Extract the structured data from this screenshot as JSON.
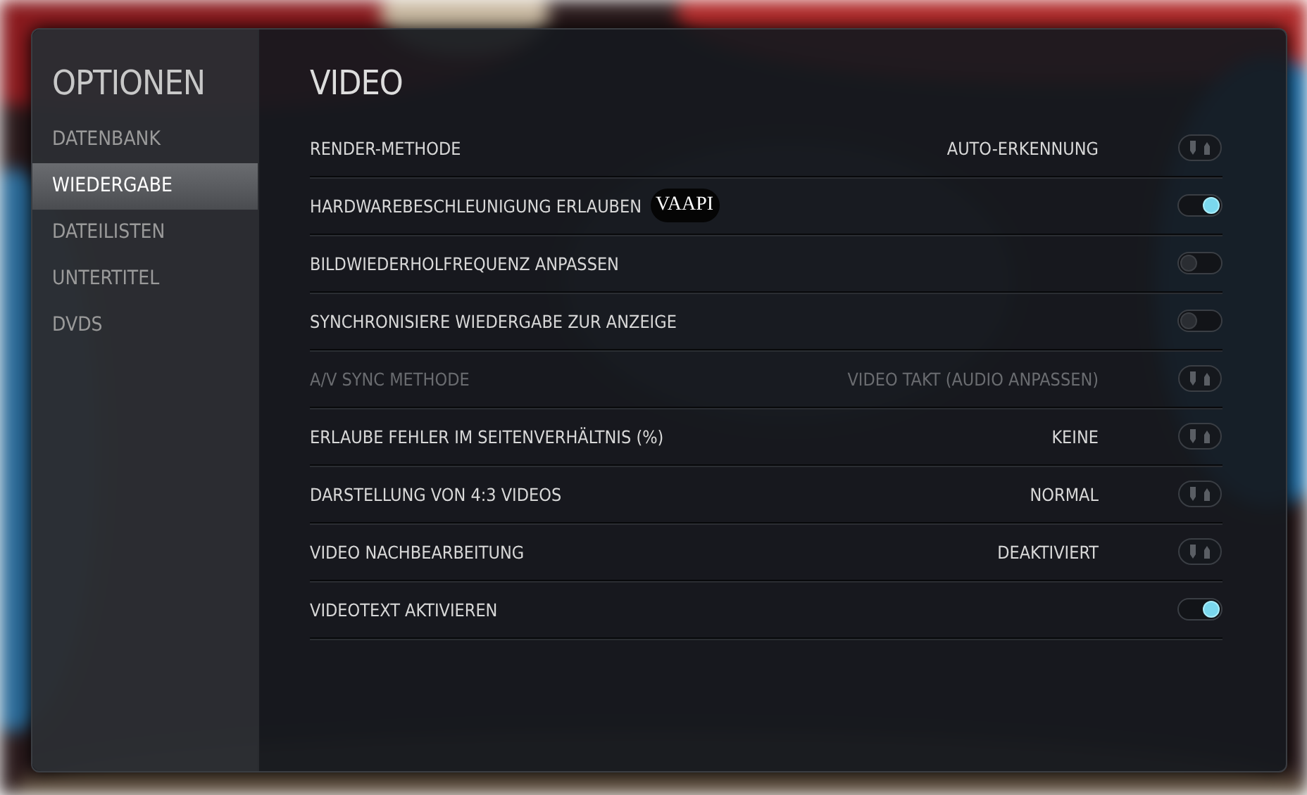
{
  "sidebar": {
    "title": "OPTIONEN",
    "items": [
      {
        "label": "DATENBANK",
        "selected": false
      },
      {
        "label": "WIEDERGABE",
        "selected": true
      },
      {
        "label": "DATEILISTEN",
        "selected": false
      },
      {
        "label": "UNTERTITEL",
        "selected": false
      },
      {
        "label": "DVDS",
        "selected": false
      }
    ]
  },
  "section": {
    "title": "VIDEO",
    "settings": [
      {
        "kind": "spinner",
        "label": "RENDER-METHODE",
        "value": "AUTO-ERKENNUNG",
        "disabled": false
      },
      {
        "kind": "toggle",
        "label": "HARDWAREBESCHLEUNIGUNG ERLAUBEN",
        "note": "VAAPI",
        "on": true,
        "disabled": false
      },
      {
        "kind": "toggle",
        "label": "BILDWIEDERHOLFREQUENZ ANPASSEN",
        "on": false,
        "disabled": false
      },
      {
        "kind": "toggle",
        "label": "SYNCHRONISIERE WIEDERGABE ZUR ANZEIGE",
        "on": false,
        "disabled": false
      },
      {
        "kind": "spinner",
        "label": "A/V SYNC METHODE",
        "value": "VIDEO TAKT (AUDIO ANPASSEN)",
        "disabled": true
      },
      {
        "kind": "spinner",
        "label": "ERLAUBE FEHLER IM SEITENVERHÄLTNIS (%)",
        "value": "KEINE",
        "disabled": false
      },
      {
        "kind": "spinner",
        "label": "DARSTELLUNG VON 4:3 VIDEOS",
        "value": "NORMAL",
        "disabled": false
      },
      {
        "kind": "spinner",
        "label": "VIDEO NACHBEARBEITUNG",
        "value": "DEAKTIVIERT",
        "disabled": false
      },
      {
        "kind": "toggle",
        "label": "VIDEOTEXT AKTIVIEREN",
        "on": true,
        "disabled": false
      }
    ]
  }
}
